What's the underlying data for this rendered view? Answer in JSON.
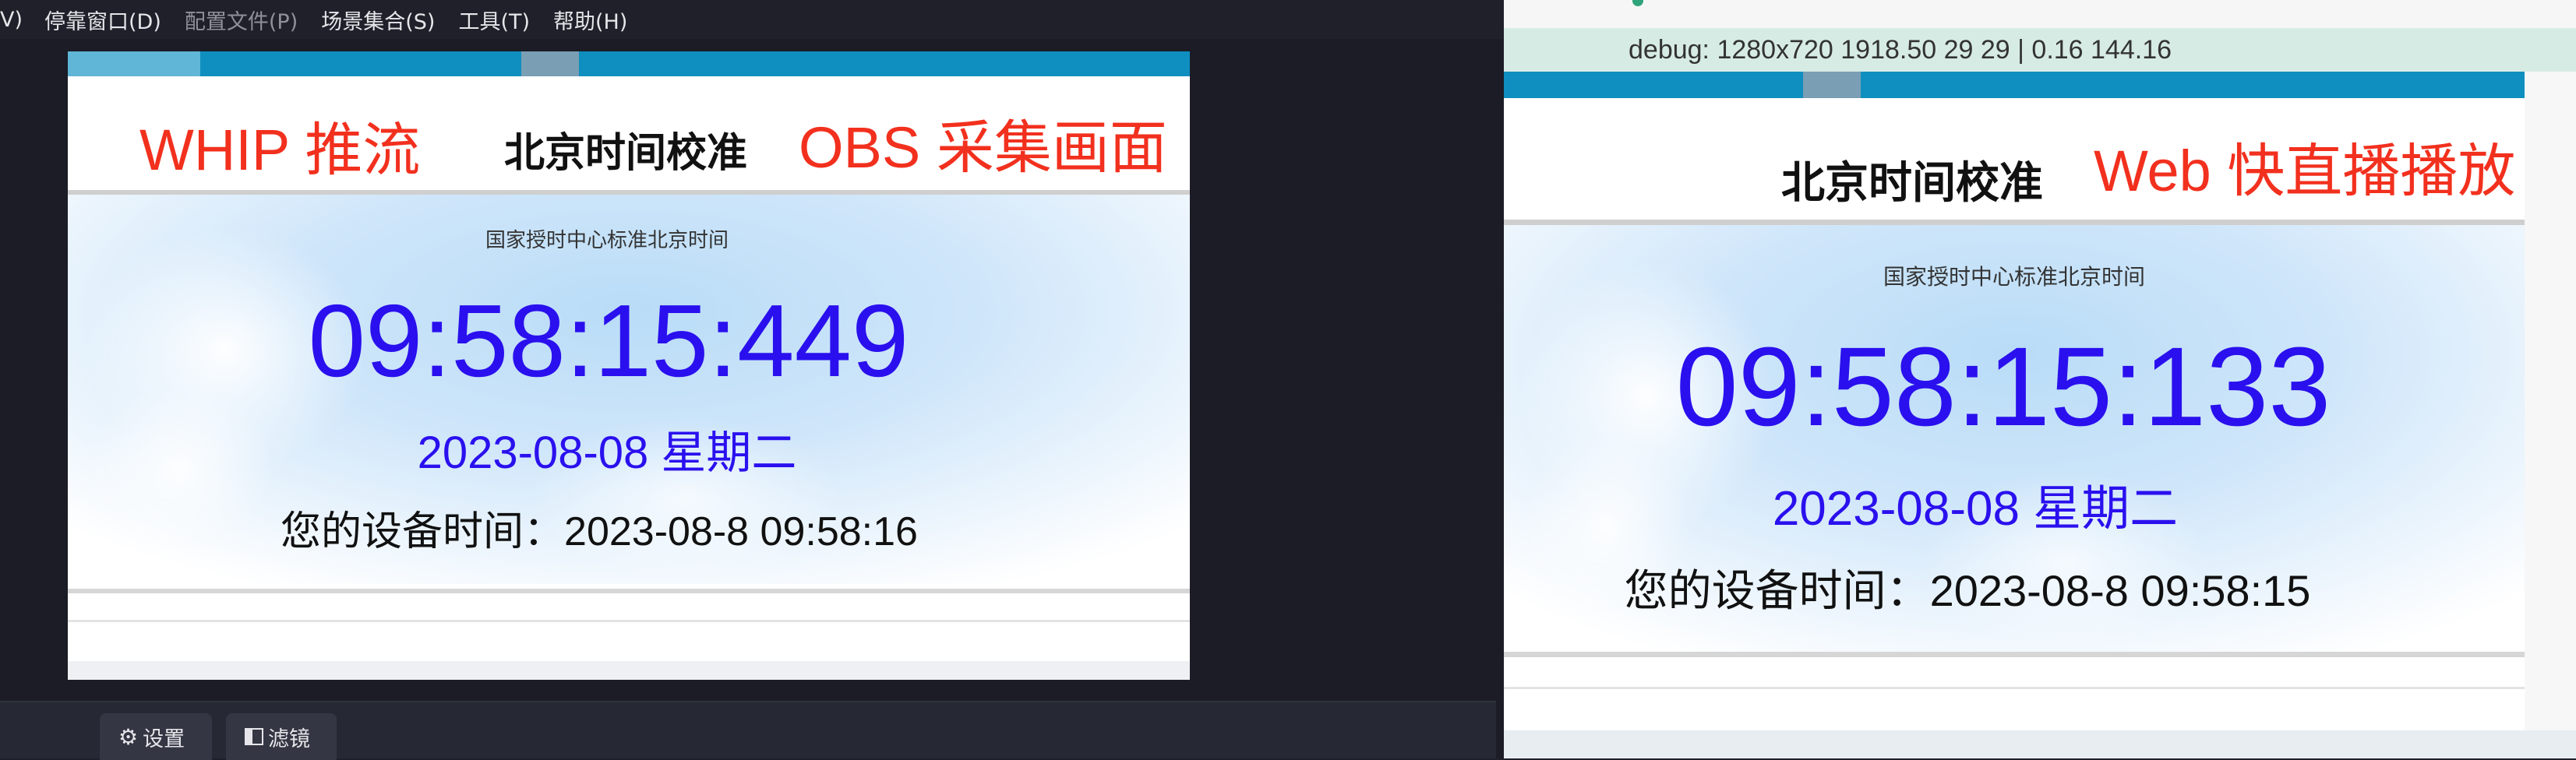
{
  "obs": {
    "menu": [
      {
        "label": "V)",
        "dim": false
      },
      {
        "label": "停靠窗口(D)",
        "dim": false
      },
      {
        "label": "配置文件(P)",
        "dim": true
      },
      {
        "label": "场景集合(S)",
        "dim": false
      },
      {
        "label": "工具(T)",
        "dim": false
      },
      {
        "label": "帮助(H)",
        "dim": false
      }
    ],
    "preview": {
      "red_left": "WHIP 推流",
      "title": "北京时间校准",
      "red_right": "OBS 采集画面",
      "subtitle": "国家授时中心标准北京时间",
      "clock": "09:58:15:449",
      "date": "2023-08-08 星期二",
      "device_time": "您的设备时间：2023-08-8 09:58:16"
    },
    "dock": {
      "settings_label": "设置",
      "settings_icon": "gear-icon",
      "filters_label": "滤镜",
      "filters_icon": "filter-icon"
    }
  },
  "web": {
    "debug": "debug: 1280x720 1918.50 29 29 | 0.16 144.16",
    "page": {
      "title": "北京时间校准",
      "red_right": "Web 快直播播放",
      "subtitle": "国家授时中心标准北京时间",
      "clock": "09:58:15:133",
      "date": "2023-08-08 星期二",
      "device_time": "您的设备时间：2023-08-8 09:58:15"
    }
  },
  "colors": {
    "accent_blue": "#2a10ee",
    "annotation_red": "#f2301e",
    "strip_blue": "#0f8fbf",
    "debug_bg": "#d7ebe5"
  }
}
